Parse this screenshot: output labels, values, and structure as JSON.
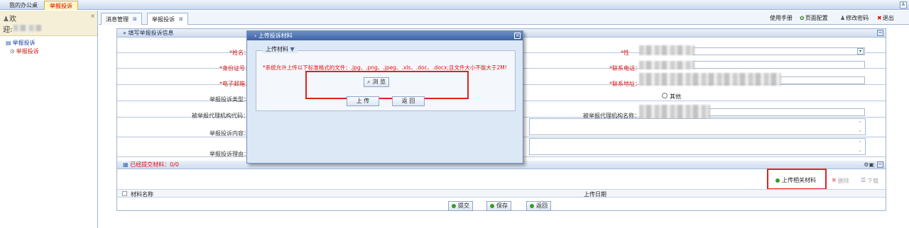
{
  "top_tabs": [
    "我的办公桌",
    "举报投诉"
  ],
  "sidebar": {
    "welcome_line1": "欢",
    "welcome_line2": "迎:",
    "tree": {
      "root": "举报投诉",
      "child": "举报投诉"
    }
  },
  "main_tabs": [
    "消息管理",
    "举报投诉"
  ],
  "toolbar": {
    "manual": "使用手册",
    "page_config": "页面配置",
    "change_password": "修改密码",
    "logout": "退出"
  },
  "form": {
    "panel_title": "填写举报投诉信息",
    "labels": {
      "name": "*姓名：",
      "id_no": "*身份证号：",
      "email": "*电子邮箱：",
      "complaint_type": "举报投诉类型：",
      "agency_code": "被举报代理机构代码：",
      "content": "举报投诉内容：",
      "reason": "举报投诉理由：",
      "right_phone": "*联系电话：",
      "right_address": "*联系地址：",
      "right_agency_name": "被举报代理机构名称："
    },
    "other_option": "其他"
  },
  "materials": {
    "header": "已经提交材料：0/0",
    "upload_button": "上传相关材料",
    "delete_button": "删除",
    "download_button": "下载",
    "col_name": "材料名称",
    "col_date": "上传日期"
  },
  "actions": {
    "submit": "提交",
    "save": "保存",
    "back": "返回"
  },
  "dialog": {
    "title": "上传投诉材料",
    "legend": "上传材料",
    "notice": "*系统允许上传以下标准格式的文件：.jpg、.png、.jpeg、.xls、.doc、.docx;且文件大小不能大于2M!",
    "browse": "浏 览",
    "upload": "上 传",
    "back": "返 回"
  }
}
